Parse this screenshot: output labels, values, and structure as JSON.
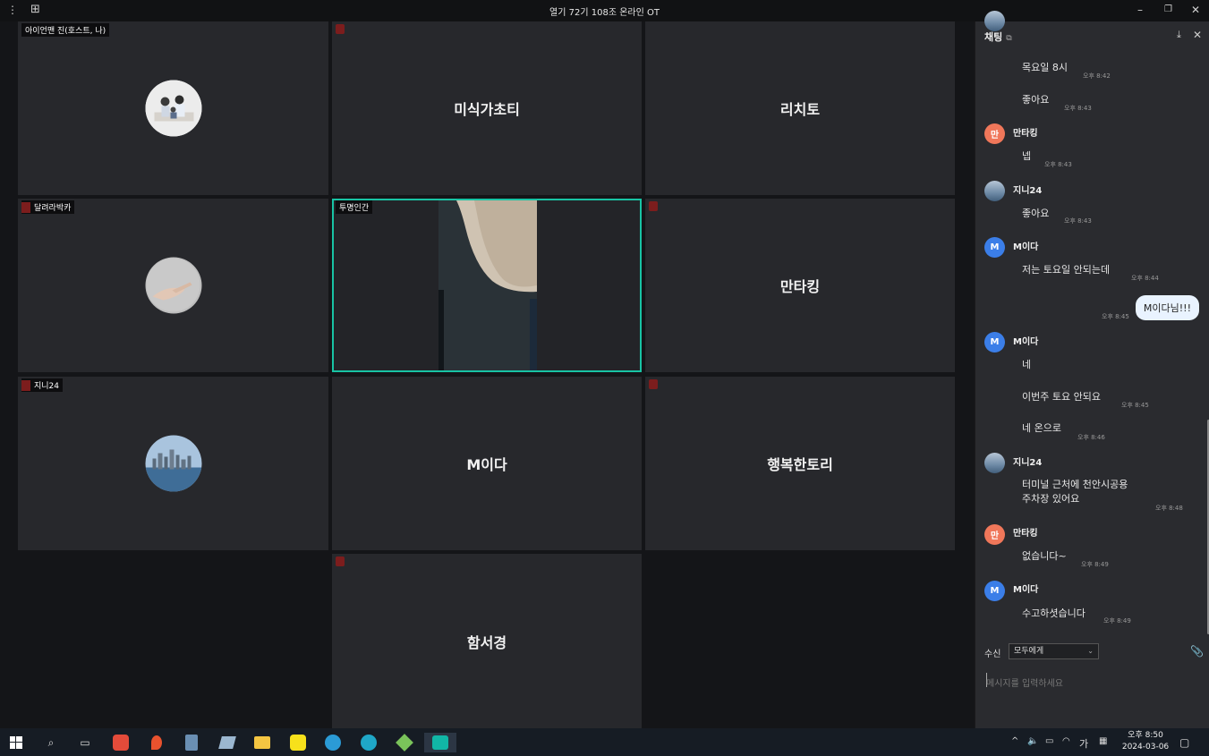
{
  "window": {
    "title": "열기 72기 108조 온라인 OT"
  },
  "tiles": [
    {
      "id": "t1",
      "tag": "아이언맨 진(호스트, 나)",
      "big_name": "",
      "avatar": "family-photo",
      "mic_muted": false
    },
    {
      "id": "t2",
      "tag": "",
      "big_name": "미식가초티",
      "avatar": "",
      "mic_muted": true
    },
    {
      "id": "t3",
      "tag": "",
      "big_name": "리치토",
      "avatar": "",
      "mic_muted": false
    },
    {
      "id": "t4",
      "tag": "달려라박카",
      "big_name": "",
      "avatar": "hand-photo",
      "mic_muted": true
    },
    {
      "id": "t5",
      "tag": "투명인간",
      "big_name": "",
      "avatar": "",
      "mic_muted": false,
      "active_speaker": true
    },
    {
      "id": "t6",
      "tag": "",
      "big_name": "만타킹",
      "avatar": "",
      "mic_muted": true
    },
    {
      "id": "t7",
      "tag": "지니24",
      "big_name": "",
      "avatar": "city-photo",
      "mic_muted": true
    },
    {
      "id": "t8",
      "tag": "",
      "big_name": "M이다",
      "avatar": "",
      "mic_muted": false
    },
    {
      "id": "t9",
      "tag": "",
      "big_name": "행복한토리",
      "avatar": "",
      "mic_muted": true
    },
    {
      "id": "t10",
      "tag": "",
      "big_name": "함서경",
      "avatar": "",
      "mic_muted": true
    }
  ],
  "chat": {
    "title": "채팅",
    "icons": [
      "popout-icon",
      "download-icon",
      "close-icon"
    ],
    "messages": [
      {
        "text": "목요일 8시",
        "time": "오후 8:42"
      },
      {
        "text": "좋아요",
        "time": "오후 8:43"
      },
      {
        "sender": "만타킹",
        "badge": "만",
        "text": "넵",
        "time": "오후 8:43"
      },
      {
        "sender": "지니24",
        "text": "좋아요",
        "time": "오후 8:43"
      },
      {
        "sender": "M이다",
        "badge": "M",
        "text": "저는 토요일 안되는데",
        "time": "오후 8:44"
      },
      {
        "mine": true,
        "text": "M이다님!!!",
        "time": "오후 8:45"
      },
      {
        "sender": "M이다",
        "badge": "M",
        "text": "네",
        "time": ""
      },
      {
        "text": "이번주 토요 안되요",
        "time": "오후 8:45"
      },
      {
        "text": "네 온으로",
        "time": "오후 8:46"
      },
      {
        "sender": "지니24",
        "text": "터미널 근처에 천안시공용\n주차장 있어요",
        "time": "오후 8:48"
      },
      {
        "sender": "만타킹",
        "badge": "만",
        "text": "없습니다~",
        "time": "오후 8:49"
      },
      {
        "sender": "M이다",
        "badge": "M",
        "text": "수고하셧습니다",
        "time": "오후 8:49"
      }
    ],
    "recipient_label": "수신",
    "recipient_value": "모두에게",
    "input_placeholder": "메시지를 입력하세요"
  },
  "taskbar": {
    "apps": [
      "windows-start-icon",
      "search-icon",
      "task-view-icon",
      "app-red-icon",
      "maps-icon",
      "calculator-icon",
      "notes-icon",
      "file-explorer-icon",
      "kakaotalk-icon",
      "bird-app-icon",
      "edge-icon",
      "app-kite-icon",
      "video-call-icon"
    ],
    "ime": "가",
    "time": "오후 8:50",
    "date": "2024-03-06"
  }
}
